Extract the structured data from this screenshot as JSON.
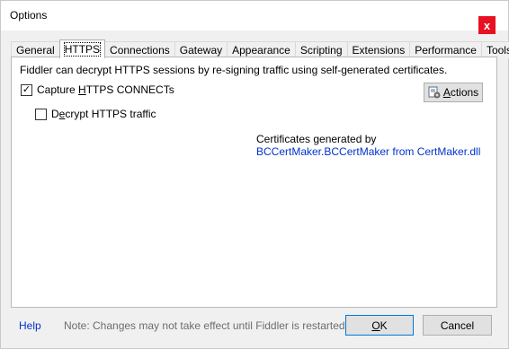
{
  "window": {
    "title": "Options",
    "close_label": "x"
  },
  "tabs": [
    {
      "label": "General"
    },
    {
      "label": "HTTPS"
    },
    {
      "label": "Connections"
    },
    {
      "label": "Gateway"
    },
    {
      "label": "Appearance"
    },
    {
      "label": "Scripting"
    },
    {
      "label": "Extensions"
    },
    {
      "label": "Performance"
    },
    {
      "label": "Tools"
    }
  ],
  "https": {
    "intro": "Fiddler can decrypt HTTPS sessions by re-signing traffic using self-generated certificates.",
    "capture": {
      "pre": "Capture ",
      "mnemonic": "H",
      "post": "TTPS CONNECTs",
      "checked": true
    },
    "decrypt": {
      "pre": "D",
      "mnemonic": "e",
      "post": "crypt HTTPS traffic",
      "checked": false
    },
    "actions": {
      "mnemonic": "A",
      "post": "ctions"
    },
    "cert_line1": "Certificates generated by",
    "cert_line2": "BCCertMaker.BCCertMaker from CertMaker.dll"
  },
  "footer": {
    "help": "Help",
    "note": "Note: Changes may not take effect until Fiddler is restarted.",
    "ok": {
      "mnemonic": "O",
      "post": "K"
    },
    "cancel": "Cancel"
  }
}
